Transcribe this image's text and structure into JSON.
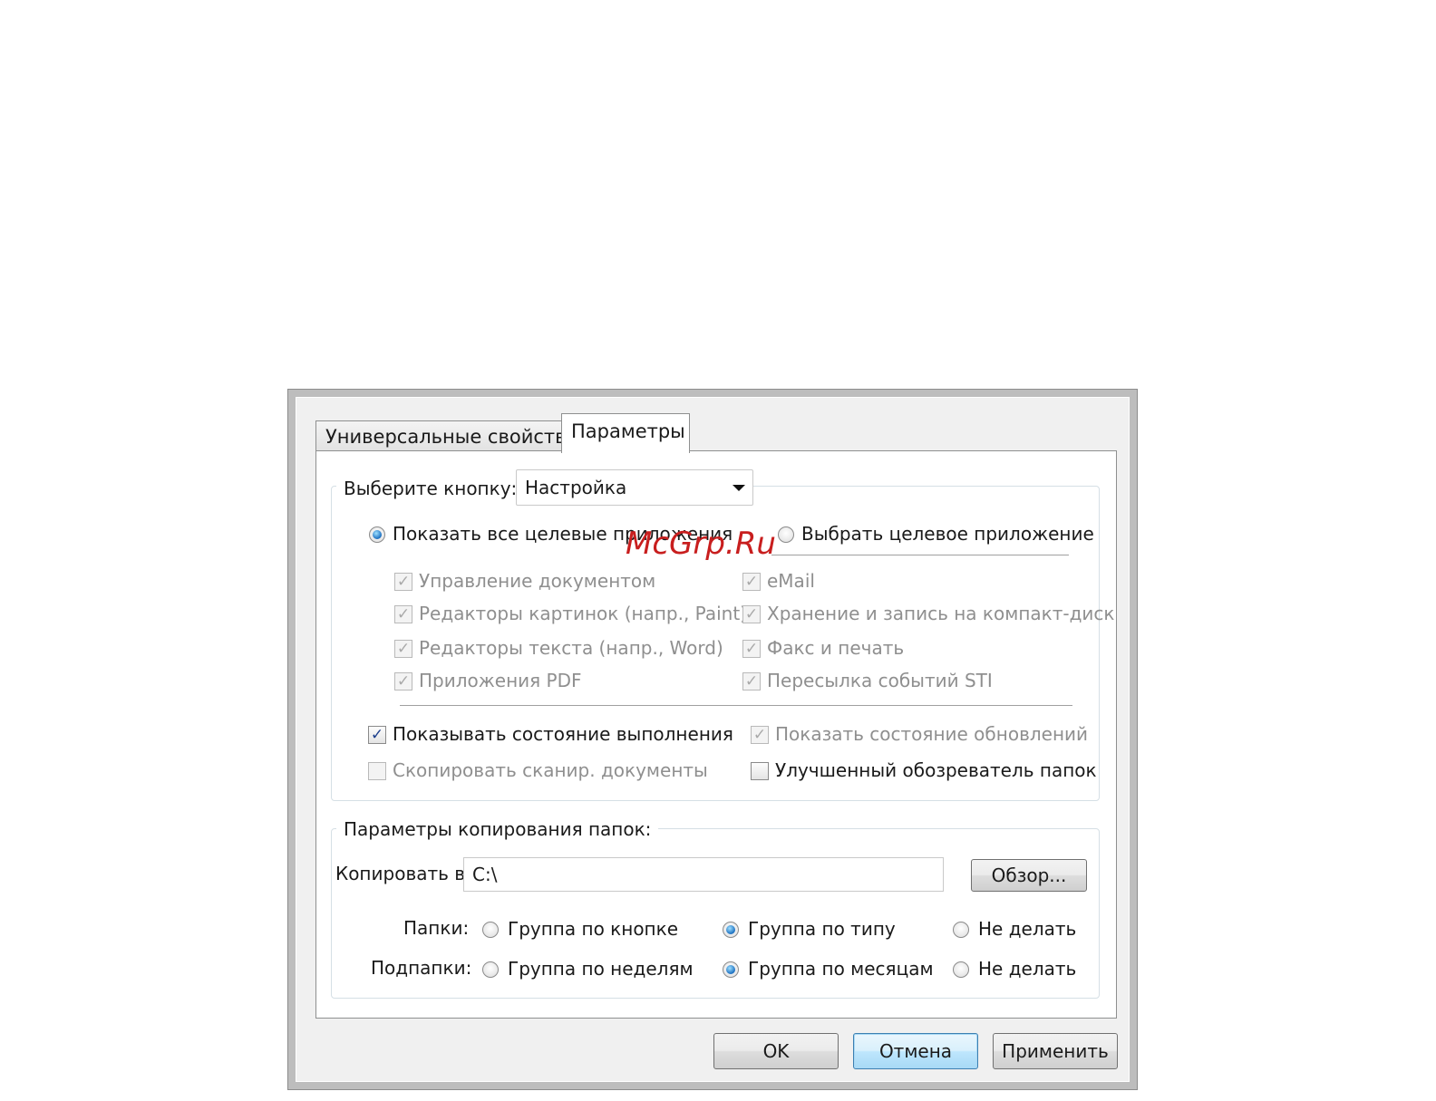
{
  "tabs": [
    {
      "label": "Универсальные свойства",
      "active": false
    },
    {
      "label": "Параметры",
      "active": true
    }
  ],
  "button_group": {
    "select_label": "Выберите кнопку:",
    "select_value": "Настройка",
    "radio_all": {
      "label": "Показать все целевые приложения",
      "selected": true
    },
    "radio_one": {
      "label": "Выбрать целевое приложение",
      "selected": false
    },
    "apps_left": [
      {
        "label": "Управление документом",
        "checked": true
      },
      {
        "label": "Редакторы картинок (напр., Paint)",
        "checked": true
      },
      {
        "label": "Редакторы текста (напр., Word)",
        "checked": true
      },
      {
        "label": "Приложения PDF",
        "checked": true
      }
    ],
    "apps_right": [
      {
        "label": "eMail",
        "checked": true
      },
      {
        "label": "Хранение и запись на компакт-диск",
        "checked": true
      },
      {
        "label": "Факс и печать",
        "checked": true
      },
      {
        "label": "Пересылка событий STI",
        "checked": true
      }
    ],
    "show_progress": {
      "label": "Показывать состояние выполнения",
      "checked": true
    },
    "show_updates": {
      "label": "Показать состояние обновлений",
      "checked": true
    },
    "copy_scanned": {
      "label": "Скопировать сканир. документы",
      "checked": false
    },
    "enhanced_browser": {
      "label": "Улучшенный обозреватель папок",
      "checked": false
    }
  },
  "copy_group": {
    "legend": "Параметры копирования папок:",
    "copy_to_label": "Копировать в:",
    "copy_to_value": "C:\\",
    "browse_label": "Обзор...",
    "folders_label": "Папки:",
    "folders_options": [
      {
        "label": "Группа по кнопке",
        "selected": false
      },
      {
        "label": "Группа по типу",
        "selected": true
      },
      {
        "label": "Не делать",
        "selected": false
      }
    ],
    "subfolders_label": "Подпапки:",
    "subfolders_options": [
      {
        "label": "Группа по неделям",
        "selected": false
      },
      {
        "label": "Группа по месяцам",
        "selected": true
      },
      {
        "label": "Не делать",
        "selected": false
      }
    ]
  },
  "footer": {
    "ok_label": "OK",
    "cancel_label": "Отмена",
    "apply_label": "Применить"
  },
  "watermark": "McGrp.Ru"
}
